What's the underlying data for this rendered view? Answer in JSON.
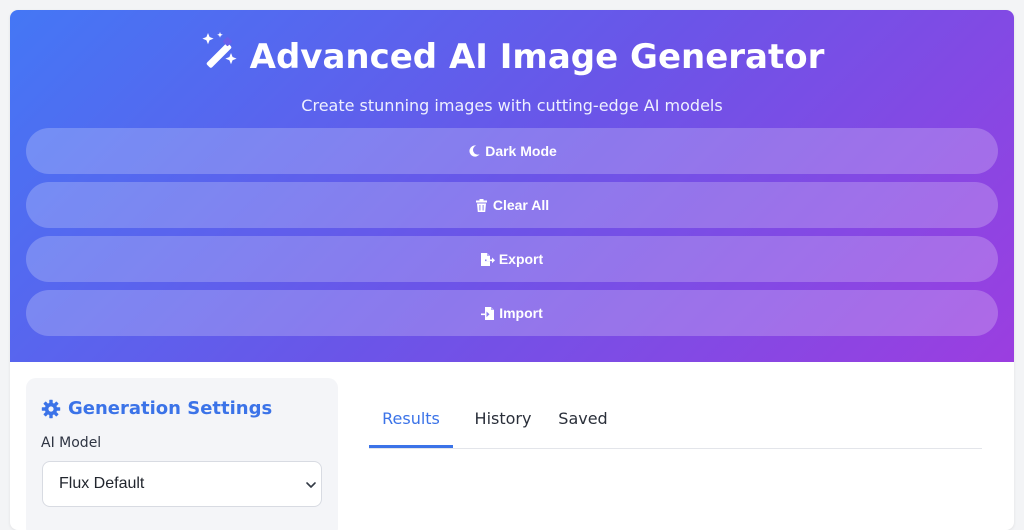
{
  "header": {
    "title": "Advanced AI Image Generator",
    "subtitle": "Create stunning images with cutting-edge AI models",
    "buttons": [
      {
        "label": "Dark Mode",
        "icon": "moon-icon"
      },
      {
        "label": "Clear All",
        "icon": "trash-icon"
      },
      {
        "label": "Export",
        "icon": "file-export-icon"
      },
      {
        "label": "Import",
        "icon": "file-import-icon"
      }
    ]
  },
  "settings": {
    "title": "Generation Settings",
    "model_label": "AI Model",
    "model_value": "Flux Default"
  },
  "tabs": [
    {
      "label": "Results",
      "active": true
    },
    {
      "label": "History",
      "active": false
    },
    {
      "label": "Saved",
      "active": false
    }
  ],
  "colors": {
    "accent": "#3b73e8",
    "gradient_start": "#4477f5",
    "gradient_end": "#9b3ee0"
  }
}
